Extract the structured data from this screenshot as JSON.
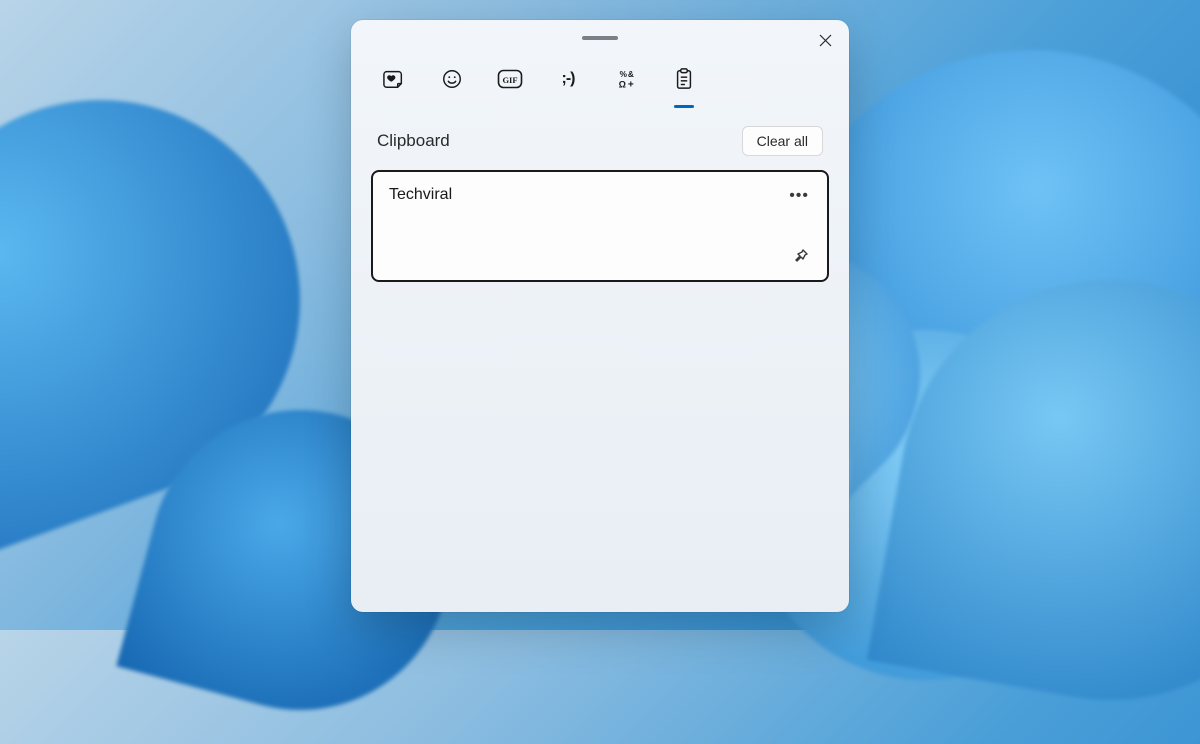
{
  "panel": {
    "section_title": "Clipboard",
    "clear_all_label": "Clear all",
    "tabs": [
      {
        "name": "recent-emoji",
        "active": false
      },
      {
        "name": "emoji",
        "active": false
      },
      {
        "name": "gif",
        "active": false
      },
      {
        "name": "kaomoji",
        "active": false
      },
      {
        "name": "symbols",
        "active": false
      },
      {
        "name": "clipboard",
        "active": true
      }
    ],
    "items": [
      {
        "text": "Techviral"
      }
    ],
    "icons": {
      "close": "close-icon",
      "more": "more-icon",
      "pin": "pin-icon"
    },
    "colors": {
      "accent": "#0067c0",
      "panel_bg": "#f2f6fa",
      "item_border": "#1a1a1a"
    }
  }
}
